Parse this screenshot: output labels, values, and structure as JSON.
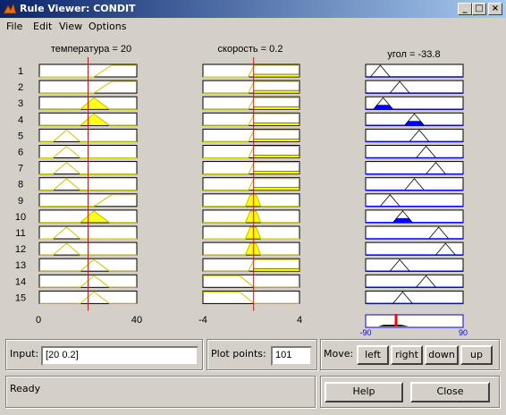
{
  "window": {
    "title": "Rule Viewer: CONDIT",
    "min_glyph": "_",
    "max_glyph": "□",
    "close_glyph": "×"
  },
  "menu": [
    "File",
    "Edit",
    "View",
    "Options"
  ],
  "columns": [
    {
      "name": "температура = 20",
      "min": "0",
      "max": "40"
    },
    {
      "name": "скорость = 0.2",
      "min": "-4",
      "max": "4"
    },
    {
      "name": "угол = -33.8",
      "min": "",
      "max": ""
    }
  ],
  "input_values": {
    "temperature": 20,
    "speed": 0.2,
    "angle": -33.8
  },
  "ranges": {
    "temperature": [
      0,
      40
    ],
    "speed": [
      -4,
      4
    ]
  },
  "rules": [
    {
      "n": "1",
      "t": "H",
      "s": "H",
      "a": 0.15,
      "fire": 0
    },
    {
      "n": "2",
      "t": "H",
      "s": "H",
      "a": 0.35,
      "fire": 0
    },
    {
      "n": "3",
      "t": "M",
      "s": "H",
      "a": 0.18,
      "fire": 0.33
    },
    {
      "n": "4",
      "t": "M",
      "s": "H",
      "a": 0.5,
      "fire": 0.33
    },
    {
      "n": "5",
      "t": "L",
      "s": "H",
      "a": 0.55,
      "fire": 0
    },
    {
      "n": "6",
      "t": "L",
      "s": "H",
      "a": 0.62,
      "fire": 0
    },
    {
      "n": "7",
      "t": "L",
      "s": "H",
      "a": 0.72,
      "fire": 0
    },
    {
      "n": "8",
      "t": "L",
      "s": "H",
      "a": 0.5,
      "fire": 0
    },
    {
      "n": "9",
      "t": "H",
      "s": "Z",
      "a": 0.25,
      "fire": 0
    },
    {
      "n": "10",
      "t": "M",
      "s": "Z",
      "a": 0.38,
      "fire": 0.33
    },
    {
      "n": "11",
      "t": "L",
      "s": "Z",
      "a": 0.75,
      "fire": 0
    },
    {
      "n": "12",
      "t": "L",
      "s": "Z",
      "a": 0.82,
      "fire": 0
    },
    {
      "n": "13",
      "t": "M",
      "s": "H",
      "a": 0.35,
      "fire": 0
    },
    {
      "n": "14",
      "t": "M",
      "s": "L",
      "a": 0.62,
      "fire": 0
    },
    {
      "n": "15",
      "t": "M",
      "s": "L",
      "a": 0.38,
      "fire": 0
    }
  ],
  "output": {
    "value": -33.8,
    "min_tick": "-90",
    "max_tick": "90"
  },
  "input": {
    "label": "Input:",
    "value": "[20 0.2]"
  },
  "plot_points": {
    "label": "Plot points:",
    "value": "101"
  },
  "move": {
    "label": "Move:",
    "left": "left",
    "right": "right",
    "down": "down",
    "up": "up"
  },
  "status": "Ready",
  "help_label": "Help",
  "close_label": "Close",
  "colors": {
    "title_start": "#0a246a",
    "title_end": "#a6caf0",
    "input_mf": "#c8c800",
    "output_mf": "#0000ff",
    "indicator": "#ff0000",
    "fill": "#ffff00"
  }
}
